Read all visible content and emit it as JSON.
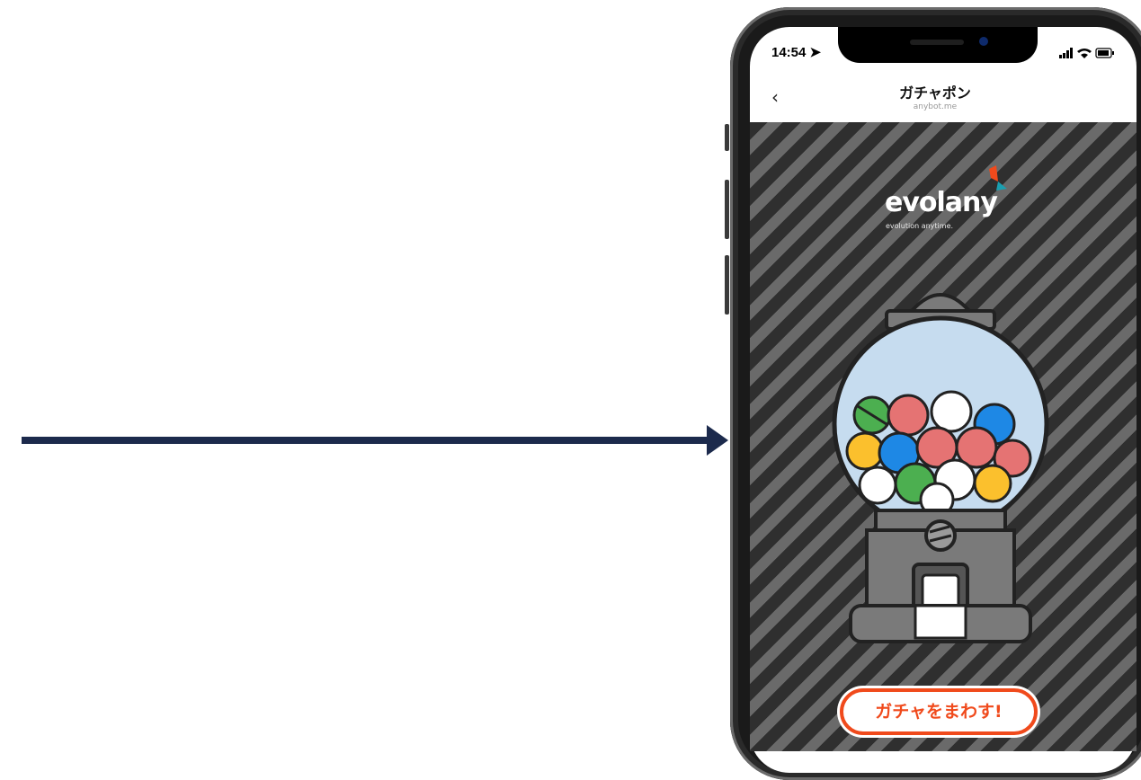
{
  "status_bar": {
    "time": "14:54",
    "icons": "▮▮ ≋ ▭"
  },
  "nav": {
    "back": "‹",
    "title": "ガチャポン",
    "subtitle": "anybot.me"
  },
  "brand": {
    "logo": "evolany",
    "tagline": "evolution anytime."
  },
  "action": {
    "spin_label": "ガチャをまわす!"
  },
  "colors": {
    "arrow": "#1c2a4c",
    "accent": "#f04a1c",
    "stripe_dark": "#2f2f2f",
    "stripe_light": "#6a6a6a"
  },
  "icons": [
    "arrow-right-icon",
    "back-chevron-icon",
    "signal-icon",
    "wifi-icon",
    "battery-icon",
    "location-icon",
    "gacha-machine-icon"
  ]
}
